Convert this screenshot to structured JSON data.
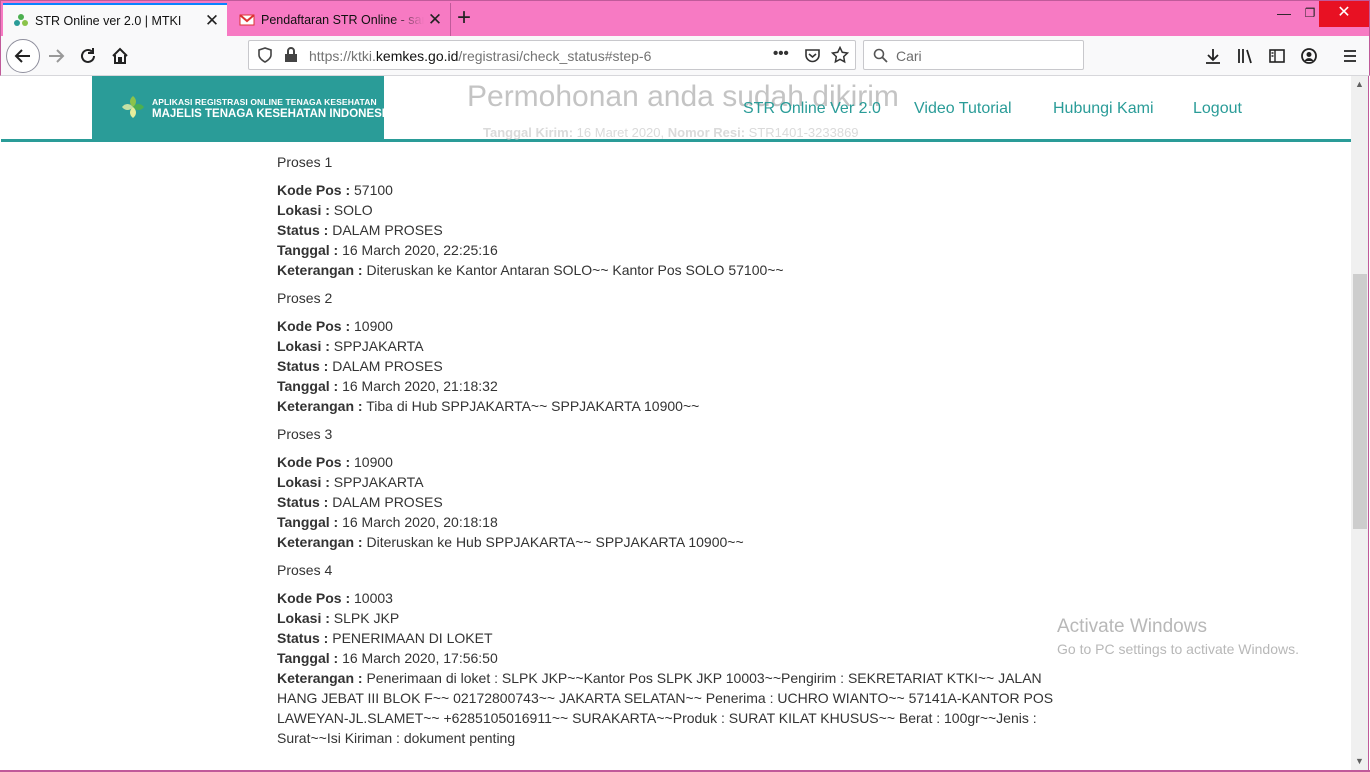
{
  "browser": {
    "tabs": [
      {
        "title": "STR Online ver 2.0 | MTKI",
        "close": "✕"
      },
      {
        "title": "Pendaftaran STR Online - sarkar",
        "close": "✕"
      }
    ],
    "new_tab": "+",
    "window_controls": {
      "minimize": "—",
      "maximize": "❐",
      "close": "✕"
    },
    "url": {
      "prefix": "https://ktki.",
      "host": "kemkes.go.id",
      "path": "/registrasi/check_status#step-6"
    },
    "page_actions": "•••",
    "search_placeholder": "Cari"
  },
  "site": {
    "logo_line1": "APLIKASI REGISTRASI ONLINE TENAGA KESEHATAN",
    "logo_line2": "MAJELIS TENAGA KESEHATAN INDONESIA",
    "ghost_title": "Permohonan anda sudah dikirim",
    "ghost_sub_label1": "Tanggal Kirim:",
    "ghost_sub_value1": "16 Maret 2020,",
    "ghost_sub_label2": "Nomor Resi:",
    "ghost_sub_value2": "STR1401-3233869",
    "menu": [
      "STR Online Ver 2.0",
      "Video Tutorial",
      "Hubungi Kami",
      "Logout"
    ],
    "accent_color": "#2a9c98"
  },
  "labels": {
    "kode_pos": "Kode Pos :",
    "lokasi": "Lokasi :",
    "status": "Status :",
    "tanggal": "Tanggal :",
    "keterangan": "Keterangan :"
  },
  "proses": [
    {
      "title": "Proses 1",
      "kode_pos": "57100",
      "lokasi": "SOLO",
      "status": "DALAM PROSES",
      "tanggal": "16 March 2020, 22:25:16",
      "keterangan": "Diteruskan ke Kantor Antaran SOLO~~ Kantor Pos SOLO 57100~~"
    },
    {
      "title": "Proses 2",
      "kode_pos": "10900",
      "lokasi": "SPPJAKARTA",
      "status": "DALAM PROSES",
      "tanggal": "16 March 2020, 21:18:32",
      "keterangan": "Tiba di Hub SPPJAKARTA~~ SPPJAKARTA 10900~~"
    },
    {
      "title": "Proses 3",
      "kode_pos": "10900",
      "lokasi": "SPPJAKARTA",
      "status": "DALAM PROSES",
      "tanggal": "16 March 2020, 20:18:18",
      "keterangan": "Diteruskan ke Hub SPPJAKARTA~~ SPPJAKARTA 10900~~"
    },
    {
      "title": "Proses 4",
      "kode_pos": "10003",
      "lokasi": "SLPK JKP",
      "status": "PENERIMAAN DI LOKET",
      "tanggal": "16 March 2020, 17:56:50",
      "keterangan": "Penerimaan di loket : SLPK JKP~~Kantor Pos SLPK JKP 10003~~Pengirim : SEKRETARIAT KTKI~~ JALAN HANG JEBAT III BLOK F~~ 02172800743~~ JAKARTA SELATAN~~ Penerima : UCHRO WIANTO~~ 57141A-KANTOR POS LAWEYAN-JL.SLAMET~~ +6285105016911~~ SURAKARTA~~Produk : SURAT KILAT KHUSUS~~ Berat : 100gr~~Jenis : Surat~~Isi Kiriman : dokument penting"
    }
  ],
  "watermark": {
    "line1": "Activate Windows",
    "line2": "Go to PC settings to activate Windows."
  },
  "scrollbar": {
    "up": "▲",
    "down": "▼"
  }
}
